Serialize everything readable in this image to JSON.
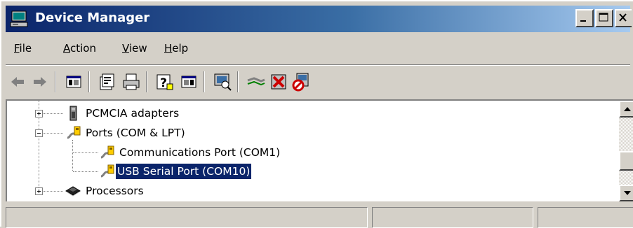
{
  "window": {
    "title": "Device Manager",
    "icon": "computer-icon",
    "titlebar_colors": [
      "#0a246a",
      "#a6caf0"
    ]
  },
  "caption_buttons": [
    "minimize-icon",
    "maximize-icon",
    "close-icon"
  ],
  "menu": [
    {
      "accel": "F",
      "rest": "ile"
    },
    {
      "accel": "A",
      "rest": "ction"
    },
    {
      "accel": "V",
      "rest": "iew"
    },
    {
      "accel": "H",
      "rest": "elp"
    }
  ],
  "toolbar": {
    "buttons": [
      "back-arrow-icon",
      "forward-arrow-icon",
      "show-hide-console-tree-icon",
      "properties-icon",
      "print-icon",
      "help-icon",
      "show-hide-action-pane-icon",
      "scan-hardware-changes-icon",
      "update-driver-icon",
      "uninstall-icon",
      "disable-icon"
    ]
  },
  "tree": {
    "items": [
      {
        "label": "PCMCIA adapters",
        "icon": "pcmcia-card-icon",
        "expander": "plus"
      },
      {
        "label": "Ports (COM & LPT)",
        "icon": "port-connector-icon",
        "expander": "minus"
      },
      {
        "label": "Communications Port (COM1)",
        "icon": "port-connector-icon"
      },
      {
        "label": "USB Serial Port (COM10)",
        "icon": "port-connector-icon",
        "selected": true
      },
      {
        "label": "Processors",
        "icon": "processor-chip-icon",
        "expander": "plus"
      }
    ],
    "selection_color": "#0a246a"
  },
  "statusbar": {
    "panels": [
      "",
      "",
      ""
    ]
  }
}
